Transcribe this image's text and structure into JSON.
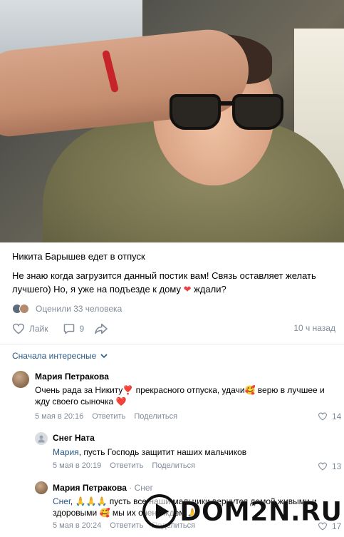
{
  "post": {
    "title": "Никита Барышев едет в отпуск",
    "body_line1": "Не знаю когда загрузится данный постик вам! Связь оставляет желать",
    "body_line2_a": "лучшего) Но, я уже на подъезде к дому",
    "body_line2_emoji": "❤",
    "body_line2_b": " ждали?",
    "reactions_text": "Оценили 33 человека",
    "like_label": "Лайк",
    "comments_count": "9",
    "timestamp": "10 ч назад"
  },
  "comments_section": {
    "sort_label": "Сначала интересные"
  },
  "comments": [
    {
      "author": "Мария Петракова",
      "text": "Очень рада за Никиту❣️ прекрасного отпуска, удачи🥰 верю в лучшее и жду своего сыночка ❤️",
      "date": "5 мая в 20:16",
      "reply_label": "Ответить",
      "share_label": "Поделиться",
      "likes": "14"
    },
    {
      "author": "Снег Ната",
      "mention": "Мария",
      "text": ", пусть Господь защитит наших мальчиков",
      "date": "5 мая в 20:19",
      "reply_label": "Ответить",
      "share_label": "Поделиться",
      "likes": "13"
    },
    {
      "author": "Мария Петракова",
      "reply_to": "Снег",
      "mention": "Снег",
      "text": ", 🙏🙏🙏 пусть все наши мальчики вернутся домой живыми и здоровыми 🥰 мы их очень ждем 🙏",
      "date": "5 мая в 20:24",
      "reply_label": "Ответить",
      "share_label": "Поделиться",
      "likes": "17"
    }
  ],
  "watermark": {
    "text": "DOM2N.RU"
  },
  "colors": {
    "link": "#2a5885",
    "secondary_text": "#818c99",
    "divider": "#e7e8ec",
    "heart": "#e64646"
  }
}
